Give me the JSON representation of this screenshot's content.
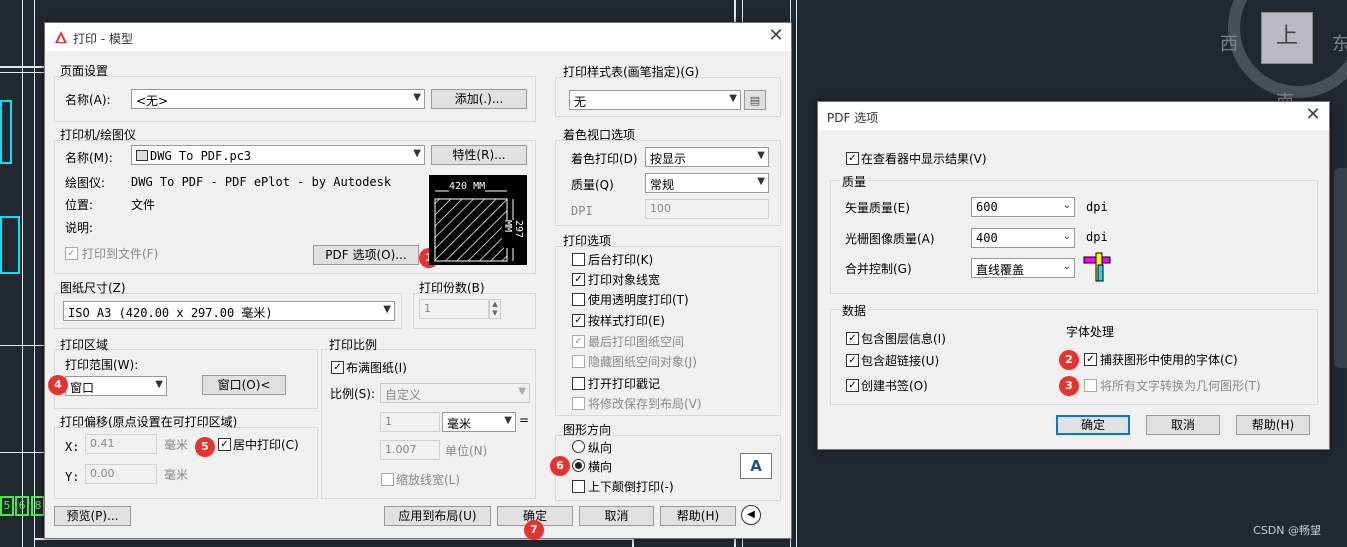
{
  "background": {
    "compass": {
      "west": "西",
      "east": "东",
      "top_face": "上",
      "south": "南"
    },
    "cad_labels": [
      "5",
      "6",
      "8"
    ],
    "watermark": "CSDN @畅望"
  },
  "print_dialog": {
    "title": "打印 - 模型",
    "page_setup": {
      "title": "页面设置",
      "name_label": "名称(A):",
      "name_value": "<无>",
      "add_button": "添加(.)..."
    },
    "printer": {
      "title": "打印机/绘图仪",
      "name_label": "名称(M):",
      "name_value": "DWG To PDF.pc3",
      "properties_button": "特性(R)...",
      "plotter_label": "绘图仪:",
      "plotter_value": "DWG To PDF - PDF ePlot - by Autodesk",
      "location_label": "位置:",
      "location_value": "文件",
      "description_label": "说明:",
      "print_to_file_label": "打印到文件(F)",
      "print_to_file_checked": true,
      "pdf_options_button": "PDF 选项(O)...",
      "preview_width": "420 MM",
      "preview_height": "297 MM"
    },
    "paper_size": {
      "title": "图纸尺寸(Z)",
      "value": "ISO A3 (420.00 x 297.00 毫米)"
    },
    "copies": {
      "title": "打印份数(B)",
      "value": "1"
    },
    "plot_area": {
      "title": "打印区域",
      "range_label": "打印范围(W):",
      "range_value": "窗口",
      "window_button": "窗口(O)<"
    },
    "plot_offset": {
      "title": "打印偏移(原点设置在可打印区域)",
      "x_label": "X:",
      "x_value": "0.41",
      "x_unit": "毫米",
      "y_label": "Y:",
      "y_value": "0.00",
      "y_unit": "毫米",
      "center_label": "居中打印(C)",
      "center_checked": true
    },
    "plot_scale": {
      "title": "打印比例",
      "fit_label": "布满图纸(I)",
      "fit_checked": true,
      "scale_label": "比例(S):",
      "scale_value": "自定义",
      "value1": "1",
      "unit_value": "毫米",
      "equals": "=",
      "value2": "1.007",
      "unit2_label": "单位(N)",
      "lineweight_label": "缩放线宽(L)"
    },
    "plot_style_table": {
      "title": "打印样式表(画笔指定)(G)",
      "value": "无"
    },
    "shaded_viewport": {
      "title": "着色视口选项",
      "shade_label": "着色打印(D)",
      "shade_value": "按显示",
      "quality_label": "质量(Q)",
      "quality_value": "常规",
      "dpi_label": "DPI",
      "dpi_value": "100"
    },
    "plot_options": {
      "title": "打印选项",
      "items": [
        {
          "label": "后台打印(K)",
          "checked": false,
          "disabled": false
        },
        {
          "label": "打印对象线宽",
          "checked": true,
          "disabled": false
        },
        {
          "label": "使用透明度打印(T)",
          "checked": false,
          "disabled": false
        },
        {
          "label": "按样式打印(E)",
          "checked": true,
          "disabled": false
        },
        {
          "label": "最后打印图纸空间",
          "checked": true,
          "disabled": true
        },
        {
          "label": "隐藏图纸空间对象(J)",
          "checked": false,
          "disabled": true
        },
        {
          "label": "打开打印戳记",
          "checked": false,
          "disabled": false
        },
        {
          "label": "将修改保存到布局(V)",
          "checked": false,
          "disabled": true
        }
      ]
    },
    "orientation": {
      "title": "图形方向",
      "portrait_label": "纵向",
      "landscape_label": "横向",
      "selected": "landscape",
      "upside_down_label": "上下颠倒打印(-)",
      "icon_letter": "A"
    },
    "footer": {
      "preview_button": "预览(P)...",
      "apply_button": "应用到布局(U)",
      "ok_button": "确定",
      "cancel_button": "取消",
      "help_button": "帮助(H)"
    }
  },
  "pdf_dialog": {
    "title": "PDF 选项",
    "show_in_viewer_label": "在查看器中显示结果(V)",
    "show_in_viewer_checked": true,
    "quality": {
      "title": "质量",
      "vector_label": "矢量质量(E)",
      "vector_value": "600",
      "raster_label": "光栅图像质量(A)",
      "raster_value": "400",
      "dpi_unit": "dpi",
      "merge_label": "合并控制(G)",
      "merge_value": "直线覆盖"
    },
    "data": {
      "title": "数据",
      "layer_info_label": "包含图层信息(I)",
      "hyperlinks_label": "包含超链接(U)",
      "bookmarks_label": "创建书签(O)",
      "font_handling_title": "字体处理",
      "capture_fonts_label": "捕获图形中使用的字体(C)",
      "capture_fonts_checked": true,
      "convert_text_label": "将所有文字转换为几何图形(T)",
      "convert_text_checked": false
    },
    "ok_button": "确定",
    "cancel_button": "取消",
    "help_button": "帮助(H)"
  },
  "badges": [
    "1",
    "2",
    "3",
    "4",
    "5",
    "6",
    "7"
  ],
  "colors": {
    "badge": "#e8322e",
    "focus": "#0078d7",
    "cad_cyan": "#00e5ff",
    "cad_green": "#3df03d",
    "background": "#212830"
  }
}
